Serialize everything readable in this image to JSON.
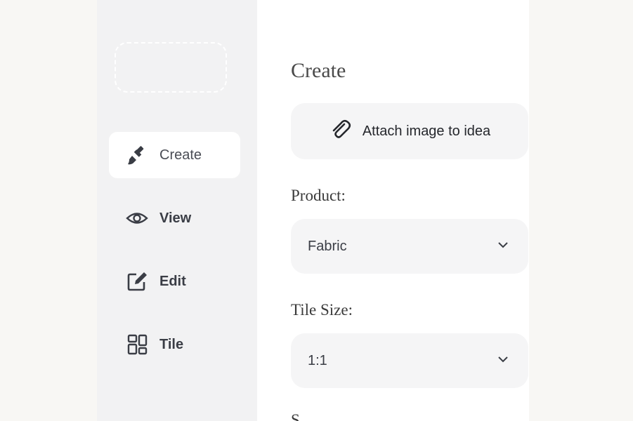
{
  "sidebar": {
    "items": [
      {
        "label": "Create",
        "icon": "paintbrush-icon"
      },
      {
        "label": "View",
        "icon": "eye-icon"
      },
      {
        "label": "Edit",
        "icon": "edit-square-icon"
      },
      {
        "label": "Tile",
        "icon": "dashboard-icon"
      }
    ]
  },
  "main": {
    "title": "Create",
    "attach_label": "Attach image to idea",
    "product": {
      "label": "Product:",
      "value": "Fabric"
    },
    "tile_size": {
      "label": "Tile Size:",
      "value": "1:1"
    },
    "next_label_partial": "S"
  },
  "colors": {
    "page_bg": "#f8f7f4",
    "sidebar_bg": "#f2f2f3",
    "field_bg": "#f5f5f6",
    "text": "#3a3d45"
  }
}
